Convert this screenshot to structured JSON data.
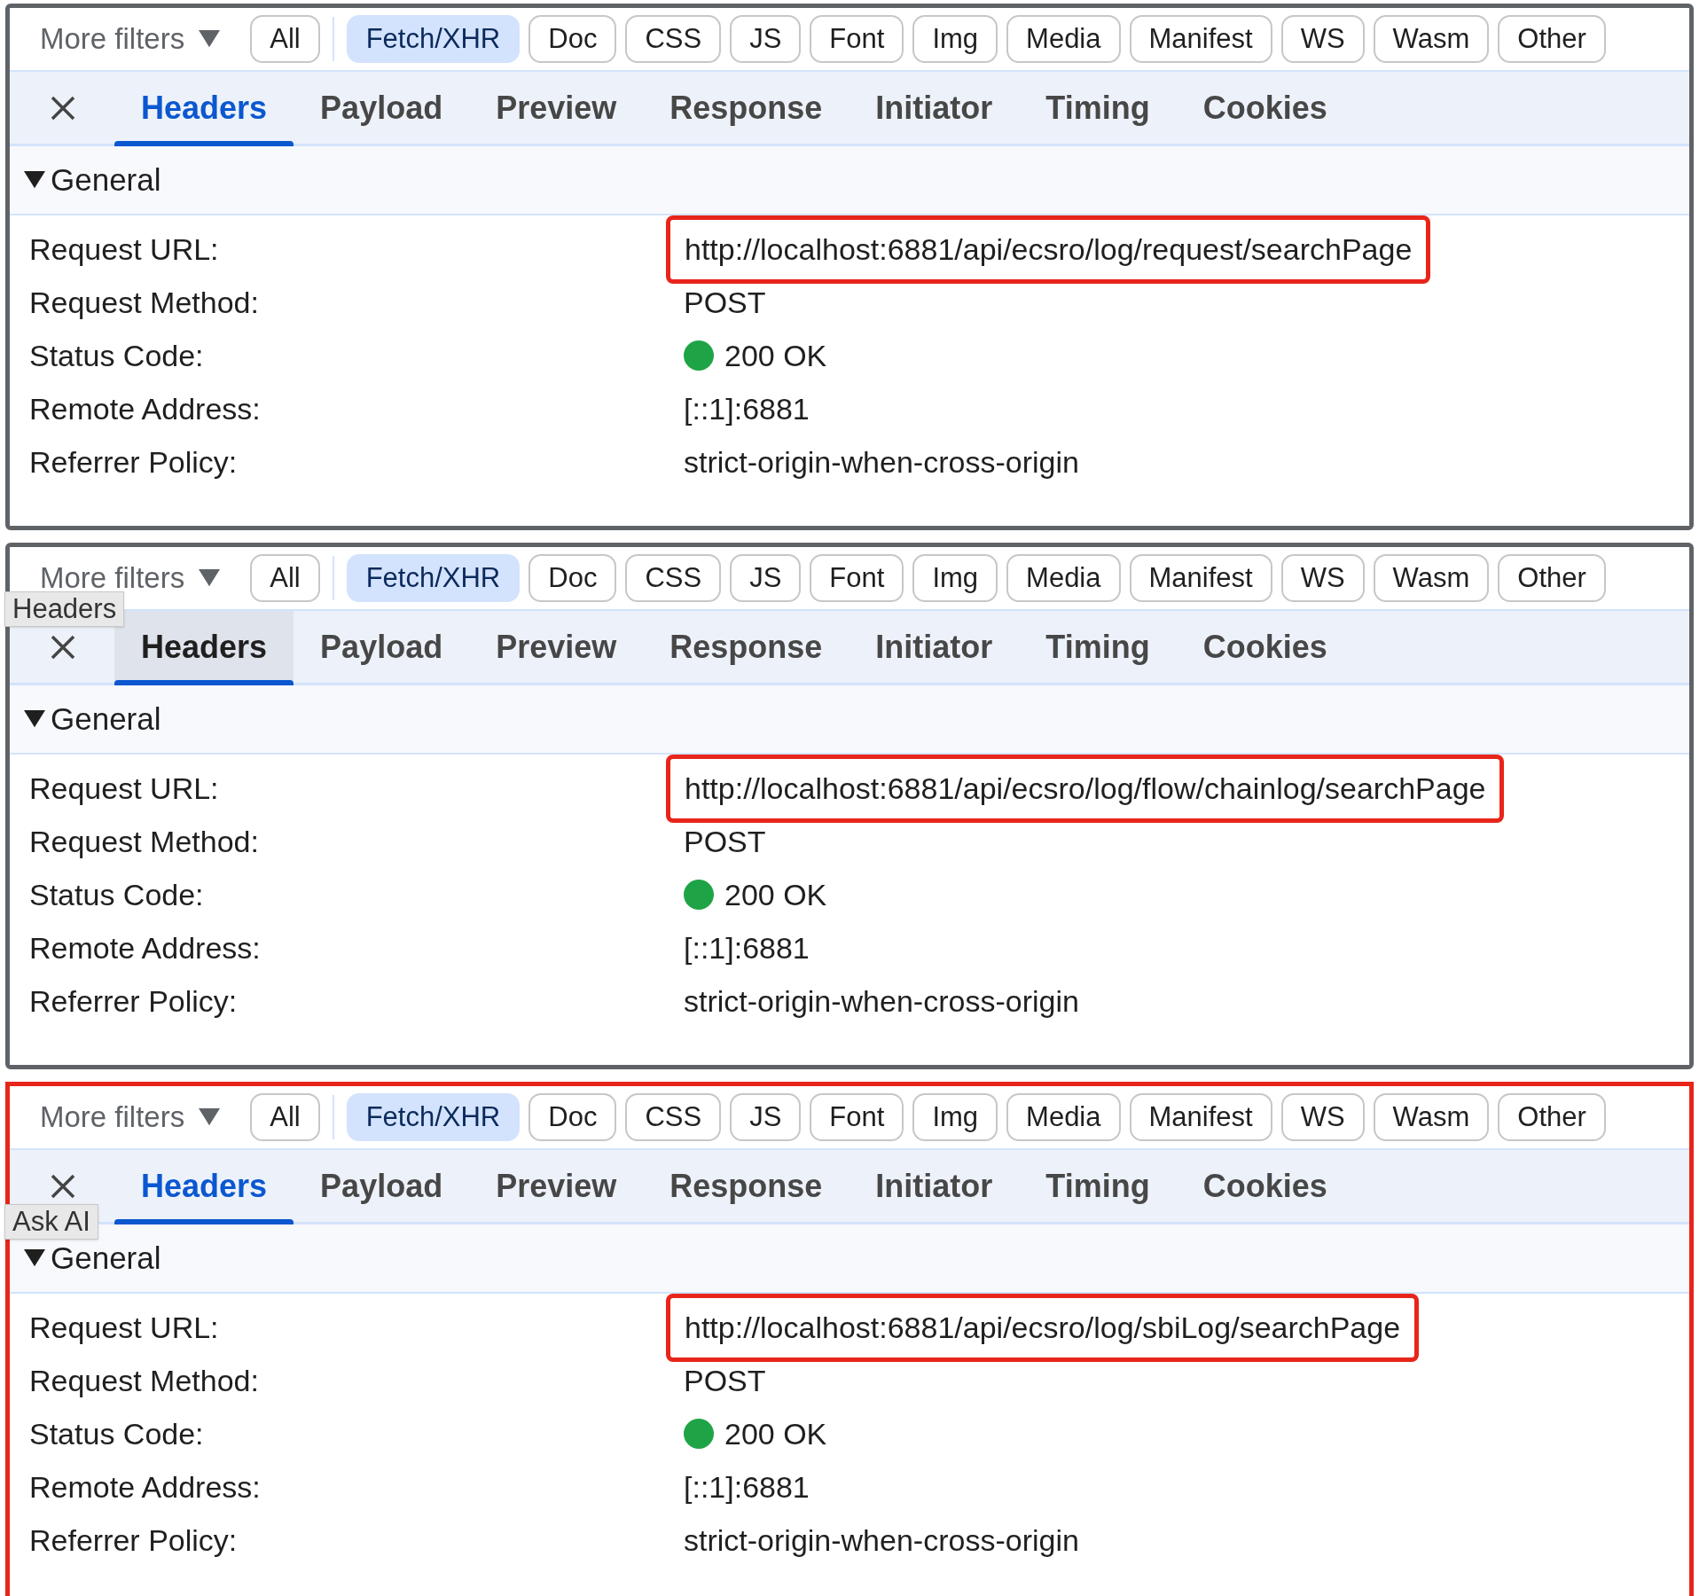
{
  "panels": [
    {
      "highlighted": false,
      "more_filters": "More filters",
      "chips": [
        {
          "label": "All",
          "selected": false
        },
        {
          "label": "Fetch/XHR",
          "selected": true
        },
        {
          "label": "Doc",
          "selected": false
        },
        {
          "label": "CSS",
          "selected": false
        },
        {
          "label": "JS",
          "selected": false
        },
        {
          "label": "Font",
          "selected": false
        },
        {
          "label": "Img",
          "selected": false
        },
        {
          "label": "Media",
          "selected": false
        },
        {
          "label": "Manifest",
          "selected": false
        },
        {
          "label": "WS",
          "selected": false
        },
        {
          "label": "Wasm",
          "selected": false
        },
        {
          "label": "Other",
          "selected": false
        }
      ],
      "tabs": [
        {
          "label": "Headers",
          "selected": true,
          "hovered": false
        },
        {
          "label": "Payload",
          "selected": false,
          "hovered": false
        },
        {
          "label": "Preview",
          "selected": false,
          "hovered": false
        },
        {
          "label": "Response",
          "selected": false,
          "hovered": false
        },
        {
          "label": "Initiator",
          "selected": false,
          "hovered": false
        },
        {
          "label": "Timing",
          "selected": false,
          "hovered": false
        },
        {
          "label": "Cookies",
          "selected": false,
          "hovered": false
        }
      ],
      "section": "General",
      "rows": [
        {
          "kind": "url",
          "label": "Request URL:",
          "value": "http://localhost:6881/api/ecsro/log/request/searchPage"
        },
        {
          "kind": "text",
          "label": "Request Method:",
          "value": "POST"
        },
        {
          "kind": "status",
          "label": "Status Code:",
          "value": "200 OK",
          "color": "#1ea446"
        },
        {
          "kind": "text",
          "label": "Remote Address:",
          "value": "[::1]:6881"
        },
        {
          "kind": "text",
          "label": "Referrer Policy:",
          "value": "strict-origin-when-cross-origin"
        }
      ]
    },
    {
      "highlighted": false,
      "more_filters": "More filters",
      "chips": [
        {
          "label": "All",
          "selected": false
        },
        {
          "label": "Fetch/XHR",
          "selected": true
        },
        {
          "label": "Doc",
          "selected": false
        },
        {
          "label": "CSS",
          "selected": false
        },
        {
          "label": "JS",
          "selected": false
        },
        {
          "label": "Font",
          "selected": false
        },
        {
          "label": "Img",
          "selected": false
        },
        {
          "label": "Media",
          "selected": false
        },
        {
          "label": "Manifest",
          "selected": false
        },
        {
          "label": "WS",
          "selected": false
        },
        {
          "label": "Wasm",
          "selected": false
        },
        {
          "label": "Other",
          "selected": false
        }
      ],
      "tabs": [
        {
          "label": "Headers",
          "selected": true,
          "hovered": true
        },
        {
          "label": "Payload",
          "selected": false,
          "hovered": false
        },
        {
          "label": "Preview",
          "selected": false,
          "hovered": false
        },
        {
          "label": "Response",
          "selected": false,
          "hovered": false
        },
        {
          "label": "Initiator",
          "selected": false,
          "hovered": false
        },
        {
          "label": "Timing",
          "selected": false,
          "hovered": false
        },
        {
          "label": "Cookies",
          "selected": false,
          "hovered": false
        }
      ],
      "tooltip": "Headers",
      "section": "General",
      "rows": [
        {
          "kind": "url",
          "label": "Request URL:",
          "value": "http://localhost:6881/api/ecsro/log/flow/chainlog/searchPage"
        },
        {
          "kind": "text",
          "label": "Request Method:",
          "value": "POST"
        },
        {
          "kind": "status",
          "label": "Status Code:",
          "value": "200 OK",
          "color": "#1ea446"
        },
        {
          "kind": "text",
          "label": "Remote Address:",
          "value": "[::1]:6881"
        },
        {
          "kind": "text",
          "label": "Referrer Policy:",
          "value": "strict-origin-when-cross-origin"
        }
      ]
    },
    {
      "highlighted": true,
      "more_filters": "More filters",
      "chips": [
        {
          "label": "All",
          "selected": false
        },
        {
          "label": "Fetch/XHR",
          "selected": true
        },
        {
          "label": "Doc",
          "selected": false
        },
        {
          "label": "CSS",
          "selected": false
        },
        {
          "label": "JS",
          "selected": false
        },
        {
          "label": "Font",
          "selected": false
        },
        {
          "label": "Img",
          "selected": false
        },
        {
          "label": "Media",
          "selected": false
        },
        {
          "label": "Manifest",
          "selected": false
        },
        {
          "label": "WS",
          "selected": false
        },
        {
          "label": "Wasm",
          "selected": false
        },
        {
          "label": "Other",
          "selected": false
        }
      ],
      "tabs": [
        {
          "label": "Headers",
          "selected": true,
          "hovered": false
        },
        {
          "label": "Payload",
          "selected": false,
          "hovered": false
        },
        {
          "label": "Preview",
          "selected": false,
          "hovered": false
        },
        {
          "label": "Response",
          "selected": false,
          "hovered": false
        },
        {
          "label": "Initiator",
          "selected": false,
          "hovered": false
        },
        {
          "label": "Timing",
          "selected": false,
          "hovered": false
        },
        {
          "label": "Cookies",
          "selected": false,
          "hovered": false
        }
      ],
      "tooltip": "Ask AI",
      "section": "General",
      "rows": [
        {
          "kind": "url",
          "label": "Request URL:",
          "value": "http://localhost:6881/api/ecsro/log/sbiLog/searchPage"
        },
        {
          "kind": "text",
          "label": "Request Method:",
          "value": "POST"
        },
        {
          "kind": "status",
          "label": "Status Code:",
          "value": "200 OK",
          "color": "#1ea446"
        },
        {
          "kind": "text",
          "label": "Remote Address:",
          "value": "[::1]:6881"
        },
        {
          "kind": "text",
          "label": "Referrer Policy:",
          "value": "strict-origin-when-cross-origin"
        }
      ]
    }
  ]
}
